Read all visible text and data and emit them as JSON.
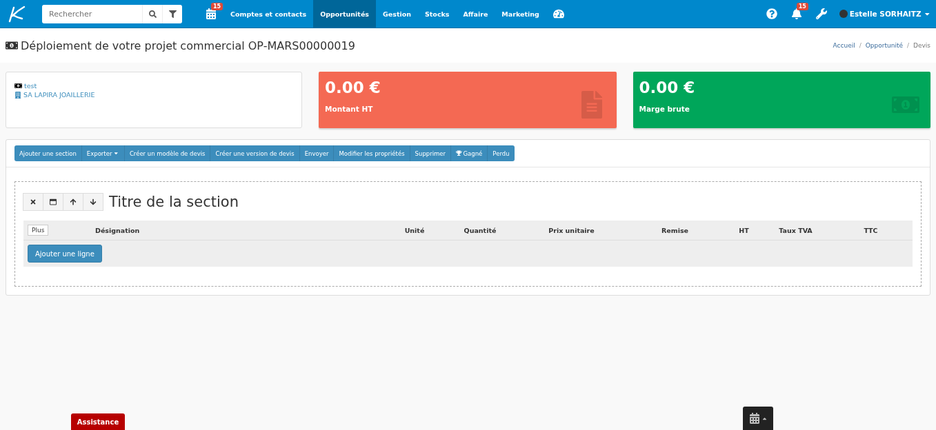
{
  "topbar": {
    "search": {
      "placeholder": "Rechercher"
    },
    "calendar_badge": "15",
    "nav": [
      {
        "label": "Comptes et contacts",
        "selected": false
      },
      {
        "label": "Opportunités",
        "selected": true
      },
      {
        "label": "Gestion",
        "selected": false
      },
      {
        "label": "Stocks",
        "selected": false
      },
      {
        "label": "Affaire",
        "selected": false
      },
      {
        "label": "Marketing",
        "selected": false
      }
    ],
    "notifications_badge": "15",
    "user": "Estelle SORHAITZ"
  },
  "page": {
    "title": "Déploiement de votre projet commercial OP-MARS00000019",
    "breadcrumb": [
      "Accueil",
      "Opportunité",
      "Devis"
    ],
    "breadcrumb_separator": "/"
  },
  "info": {
    "name": "test",
    "company": "SA LAPIRA JOAILLERIE"
  },
  "stats": [
    {
      "value": "0.00 €",
      "label": "Montant HT",
      "color": "#f46953",
      "kind": "document"
    },
    {
      "value": "0.00 €",
      "label": "Marge brute",
      "color": "#00a65a",
      "kind": "money"
    }
  ],
  "actions": [
    {
      "label": "Ajouter une section",
      "kind": "plain"
    },
    {
      "label": "Exporter",
      "kind": "dropdown"
    },
    {
      "label": "Créer un modèle de devis",
      "kind": "plain"
    },
    {
      "label": "Créer une version de devis",
      "kind": "plain"
    },
    {
      "label": "Envoyer",
      "kind": "plain"
    },
    {
      "label": "Modifier les propriétés",
      "kind": "plain"
    },
    {
      "label": "Supprimer",
      "kind": "plain"
    },
    {
      "label": "Gagné",
      "kind": "trophy"
    },
    {
      "label": "Perdu",
      "kind": "plain"
    }
  ],
  "section": {
    "title": "Titre de la section",
    "more": "Plus",
    "columns": [
      "Désignation",
      "Unité",
      "Quantité",
      "Prix unitaire",
      "Remise",
      "HT",
      "Taux TVA",
      "TTC"
    ],
    "add_line": "Ajouter une ligne"
  },
  "footer": {
    "assistance": "Assistance"
  }
}
